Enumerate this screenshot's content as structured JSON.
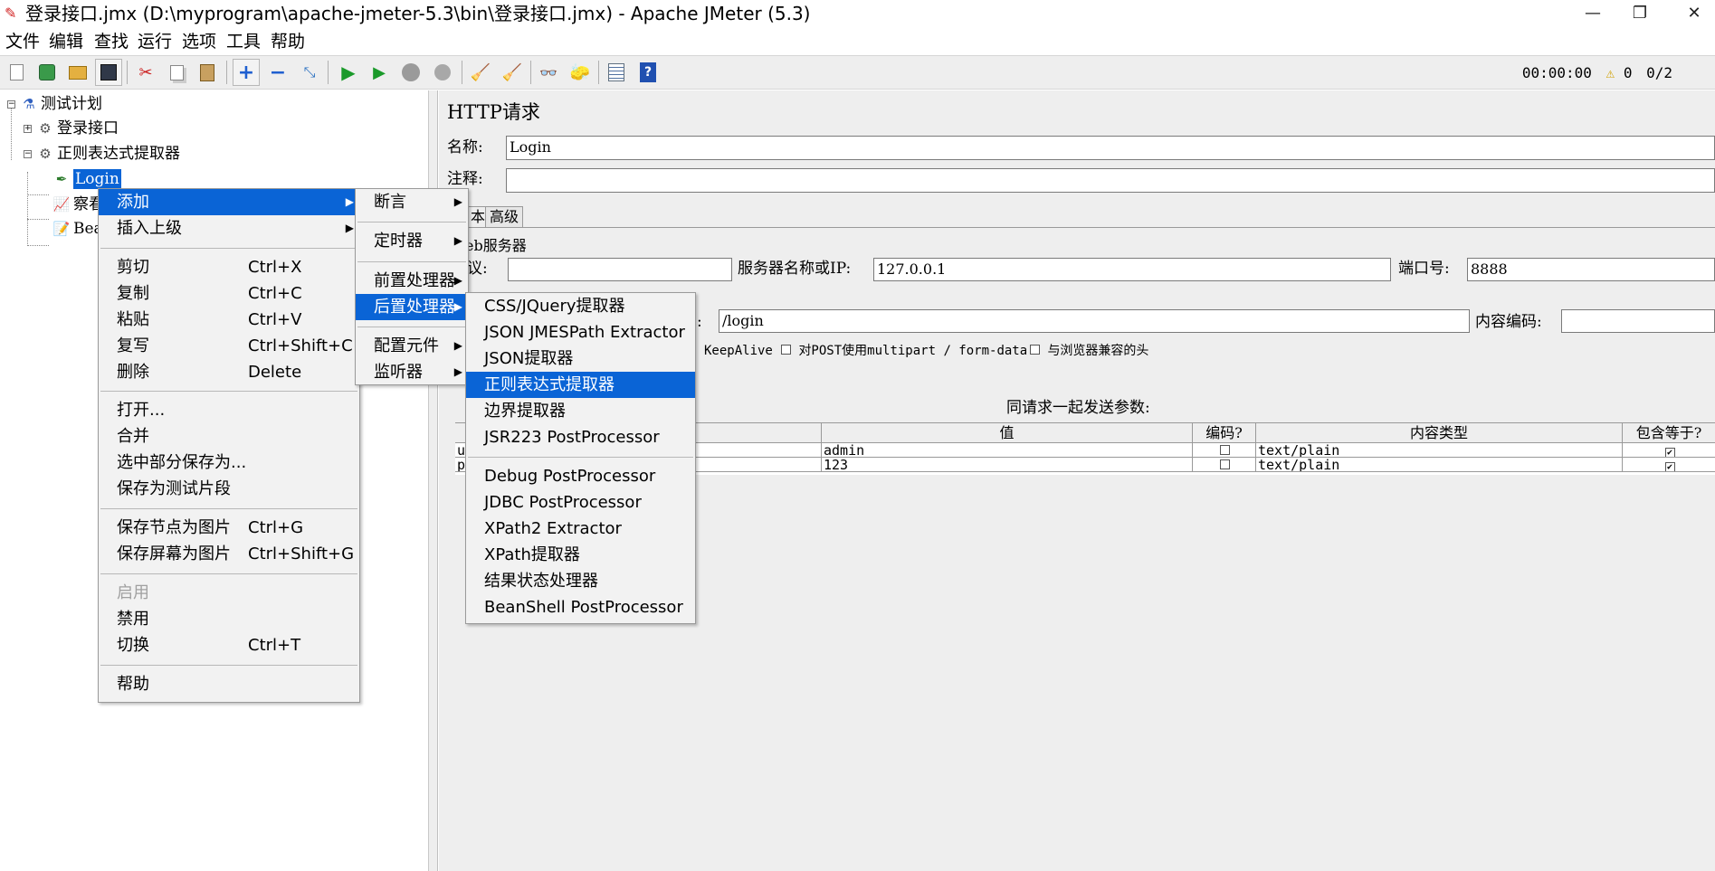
{
  "window": {
    "title": "登录接口.jmx (D:\\myprogram\\apache-jmeter-5.3\\bin\\登录接口.jmx) - Apache JMeter (5.3)",
    "minimize": "—",
    "restore": "❐",
    "close": "✕"
  },
  "menubar": [
    "文件",
    "编辑",
    "查找",
    "运行",
    "选项",
    "工具",
    "帮助"
  ],
  "toolbar": {
    "icons": [
      "new-icon",
      "templates-icon",
      "open-icon",
      "save-icon",
      "cut-icon",
      "copy-icon",
      "paste-icon",
      "expand-icon",
      "collapse-icon",
      "toggle-icon",
      "start-icon",
      "start-no-pause-icon",
      "stop-icon",
      "shutdown-icon",
      "clear-icon",
      "clear-all-icon",
      "search-icon",
      "reset-search-icon",
      "function-helper-icon",
      "help-icon"
    ],
    "timer": "00:00:00",
    "warning_count": "0",
    "threads": "0/2"
  },
  "tree": {
    "test_plan": "测试计划",
    "login_api": "登录接口",
    "regex_extractor": "正则表达式提取器",
    "login": "Login",
    "child2_partial": "察看",
    "child3_partial": "Bea"
  },
  "http_panel": {
    "title": "HTTP请求",
    "name_label": "名称:",
    "name_value": "Login",
    "comment_label": "注释:",
    "comment_value": "",
    "tabs": [
      "本",
      "高级"
    ],
    "web_server_title": "eb服务器",
    "protocol_label": "议:",
    "protocol_value": "",
    "server_label": "服务器名称或IP:",
    "server_value": "127.0.0.1",
    "port_label": "端口号:",
    "port_value": "8888",
    "path_label_partial": ":",
    "path_value": "/login",
    "encoding_label": "内容编码:",
    "encoding_value": "",
    "keepalive_label": "KeepAlive",
    "multipart_label": "对POST使用multipart / form-data",
    "browser_headers_label": "与浏览器兼容的头",
    "params_title": "同请求一起发送参数:",
    "columns": [
      "值",
      "编码?",
      "内容类型",
      "包含等于?"
    ],
    "rows": [
      {
        "name": "u",
        "value": "admin",
        "encode": false,
        "content_type": "text/plain",
        "include_equals": true
      },
      {
        "name": "p",
        "value": "123",
        "encode": false,
        "content_type": "text/plain",
        "include_equals": true
      }
    ]
  },
  "context_menu": {
    "items": [
      {
        "label": "添加",
        "shortcut": "",
        "submenu": true
      },
      {
        "label": "插入上级",
        "shortcut": "",
        "submenu": true
      },
      {
        "label": "剪切",
        "shortcut": "Ctrl+X"
      },
      {
        "label": "复制",
        "shortcut": "Ctrl+C"
      },
      {
        "label": "粘贴",
        "shortcut": "Ctrl+V"
      },
      {
        "label": "复写",
        "shortcut": "Ctrl+Shift+C"
      },
      {
        "label": "删除",
        "shortcut": "Delete"
      },
      {
        "label": "打开...",
        "shortcut": ""
      },
      {
        "label": "合并",
        "shortcut": ""
      },
      {
        "label": "选中部分保存为...",
        "shortcut": ""
      },
      {
        "label": "保存为测试片段",
        "shortcut": ""
      },
      {
        "label": "保存节点为图片",
        "shortcut": "Ctrl+G"
      },
      {
        "label": "保存屏幕为图片",
        "shortcut": "Ctrl+Shift+G"
      },
      {
        "label": "启用",
        "shortcut": ""
      },
      {
        "label": "禁用",
        "shortcut": ""
      },
      {
        "label": "切换",
        "shortcut": "Ctrl+T"
      },
      {
        "label": "帮助",
        "shortcut": ""
      }
    ]
  },
  "add_submenu": {
    "items": [
      "断言",
      "定时器",
      "前置处理器",
      "后置处理器",
      "配置元件",
      "监听器"
    ]
  },
  "post_processor_submenu": {
    "items": [
      "CSS/JQuery提取器",
      "JSON JMESPath Extractor",
      "JSON提取器",
      "正则表达式提取器",
      "边界提取器",
      "JSR223 PostProcessor",
      "Debug PostProcessor",
      "JDBC PostProcessor",
      "XPath2 Extractor",
      "XPath提取器",
      "结果状态处理器",
      "BeanShell PostProcessor"
    ]
  },
  "colors": {
    "selection": "#0a64d6",
    "panel_bg": "#eeeeee",
    "menu_bg": "#f2f2f2"
  }
}
